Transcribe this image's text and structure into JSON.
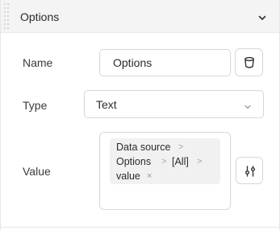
{
  "section": {
    "title": "Options"
  },
  "fields": {
    "name_label": "Name",
    "name_value": "Options",
    "type_label": "Type",
    "type_value": "Text",
    "value_label": "Value"
  },
  "value_path": {
    "segments": [
      "Data source",
      "Options",
      "[All]",
      "value"
    ],
    "separator": ">",
    "remove_glyph": "×"
  },
  "icons": {
    "header_chevron": "chevron-down-icon",
    "name_action": "cylinder-icon",
    "type_chevron": "chevron-down-icon",
    "value_action": "sliders-icon",
    "drag": "drag-handle-icon"
  },
  "colors": {
    "header_bg": "#f4f4f4",
    "border": "#d7d7d7",
    "chip_bg": "#f1f1f1",
    "text": "#2b2b2b"
  }
}
